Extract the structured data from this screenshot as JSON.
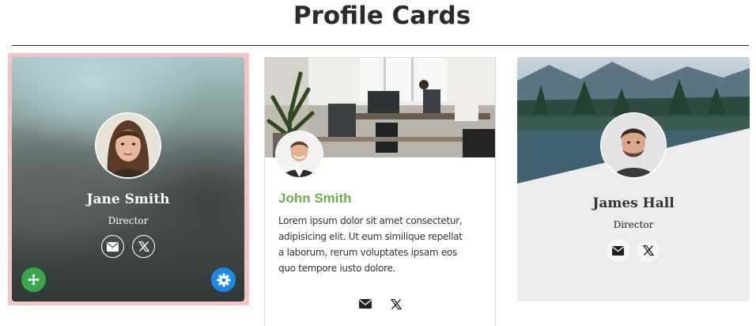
{
  "page": {
    "title": "Profile Cards"
  },
  "cards": [
    {
      "name": "Jane Smith",
      "role": "Director",
      "social": [
        "envelope-icon",
        "x-icon"
      ],
      "actions": [
        "move-icon",
        "gear-icon"
      ],
      "colors": {
        "frame": "#f3c4c4",
        "move": "#3aa64b",
        "settings": "#1e88e5"
      }
    },
    {
      "name": "John Smith",
      "body": "Lorem ipsum dolor sit amet consectetur, adipisicing elit. Ut eum similique repellat a laborum, rerum voluptates ipsam eos quo tempore iusto dolore.",
      "social": [
        "envelope-icon",
        "x-icon"
      ],
      "colors": {
        "name": "#6ab04c"
      }
    },
    {
      "name": "James Hall",
      "role": "Director",
      "social": [
        "envelope-icon",
        "x-icon"
      ]
    }
  ]
}
